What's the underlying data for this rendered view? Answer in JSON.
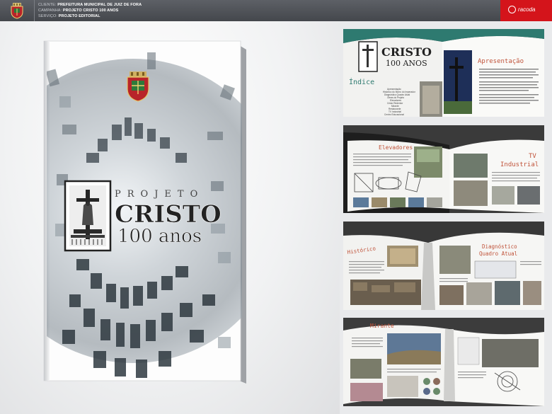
{
  "header": {
    "lines": [
      {
        "label": "CLIENTE:",
        "value": "PREFEITURA MUNICIPAL DE JUIZ DE FORA"
      },
      {
        "label": "CAMPANHA:",
        "value": "PROJETO CRISTO 100 ANOS"
      },
      {
        "label": "SERVIÇO:",
        "value": "PROJETO EDITORIAL"
      }
    ],
    "brand": "racoda",
    "brand_color": "#d4141b"
  },
  "cover": {
    "line1": "PROJETO",
    "line2": "CRISTO",
    "line3": "100 anos"
  },
  "spreads": [
    {
      "title": "CRISTO",
      "subtitle": "100 ANOS",
      "toc_title": "Índice",
      "toc_items": [
        "Apresentação",
        "Histórico do Morro do Imperador",
        "Diagnóstico Quadro Atual",
        "Obras do Projeto",
        "Elevadores",
        "Cristo Redentor",
        "Mirante",
        "Restaurante",
        "TV Industrial",
        "Centro Educacional"
      ],
      "right_title": "Apresentação"
    },
    {
      "left_title": "Elevadores",
      "right_title_a": "TV",
      "right_title_b": "Industrial"
    },
    {
      "left_title": "Histórico",
      "right_title_a": "Diagnóstico",
      "right_title_b": "Quadro Atual"
    },
    {
      "left_title": "Mirante"
    }
  ],
  "accent_color": "#c0533a",
  "teal_color": "#2e7a70"
}
